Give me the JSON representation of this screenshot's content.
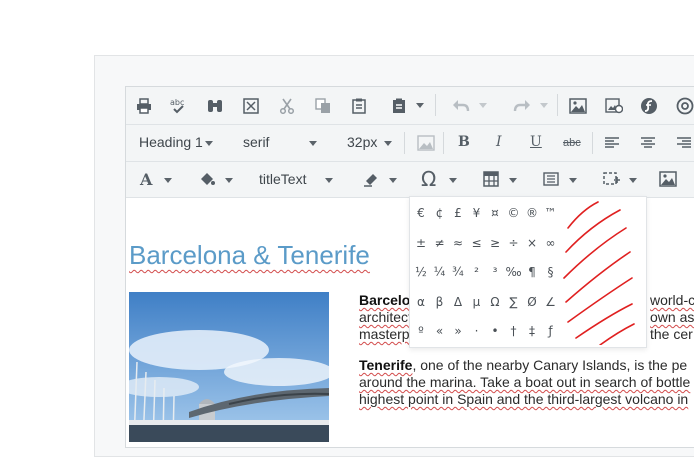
{
  "toolbar": {
    "block_format": "Heading 1",
    "font_family": "serif",
    "font_size": "32px",
    "style_class": "titleText",
    "bold": "B",
    "italic": "I",
    "underline": "U",
    "strikethrough": "abc",
    "text_color_label": "A",
    "special_character_label": "Ω"
  },
  "special_chars": {
    "rows": [
      [
        "€",
        "¢",
        "£",
        "¥",
        "¤",
        "©",
        "®",
        "™"
      ],
      [
        "±",
        "≠",
        "≈",
        "≤",
        "≥",
        "÷",
        "×",
        "∞"
      ],
      [
        "½",
        "¼",
        "¾",
        "²",
        "³",
        "‰",
        "¶",
        "§"
      ],
      [
        "α",
        "β",
        "Δ",
        "μ",
        "Ω",
        "∑",
        "Ø",
        "∠"
      ],
      [
        "º",
        "«",
        "»",
        "·",
        "•",
        "†",
        "‡",
        "ƒ"
      ]
    ]
  },
  "document": {
    "heading": "Barcelona & Tenerife",
    "p1": {
      "line1_bold": "Barcelo",
      "line1_tail": "world-cla",
      "line2_start": "architect",
      "line2_tail": "own as",
      "line3_start": "masterp",
      "line3_tail": "the cer"
    },
    "p2": {
      "bold": "Tenerife",
      "line1_rest": ", one of the nearby Canary Islands, is the pe",
      "line2": "around the marina. Take a boat out in search of bottle",
      "line3": "highest point in Spain and the third-largest volcano in"
    }
  },
  "colors": {
    "heading": "#5b9bc8",
    "toolbar_bg": "#f3f5f6",
    "annotation": "#e02020"
  }
}
